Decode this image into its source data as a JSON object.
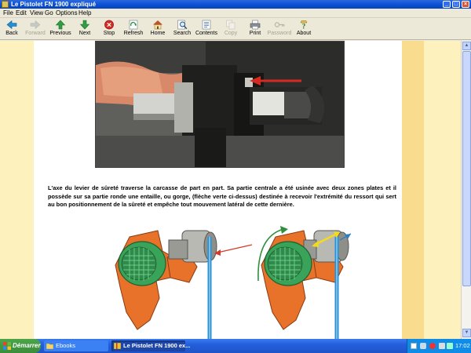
{
  "window": {
    "title": "Le Pistolet FN 1900 expliqué"
  },
  "menu": [
    "File",
    "Edit",
    "View",
    "Go",
    "Options",
    "Help"
  ],
  "toolbar": [
    {
      "label": "Back",
      "icon": "back-icon",
      "enabled": true
    },
    {
      "label": "Forward",
      "icon": "forward-icon",
      "enabled": false
    },
    {
      "label": "Previous",
      "icon": "previous-icon",
      "enabled": true
    },
    {
      "label": "Next",
      "icon": "next-icon",
      "enabled": true
    },
    {
      "label": "Stop",
      "icon": "stop-icon",
      "enabled": true
    },
    {
      "label": "Refresh",
      "icon": "refresh-icon",
      "enabled": true
    },
    {
      "label": "Home",
      "icon": "home-icon",
      "enabled": true
    },
    {
      "label": "Search",
      "icon": "search-icon",
      "enabled": true
    },
    {
      "label": "Contents",
      "icon": "contents-icon",
      "enabled": true
    },
    {
      "label": "Copy",
      "icon": "copy-icon",
      "enabled": false
    },
    {
      "label": "Print",
      "icon": "print-icon",
      "enabled": true
    },
    {
      "label": "Password",
      "icon": "password-icon",
      "enabled": false
    },
    {
      "label": "About",
      "icon": "about-icon",
      "enabled": true
    }
  ],
  "content": {
    "paragraph": "L'axe du levier de sûreté traverse la carcasse de part en part. Sa partie centrale a été usinée avec deux zones plates et il possède sur sa partie ronde une entaille, ou gorge, (flèche verte ci-dessus) destinée à recevoir l'extrémité du ressort qui sert au bon positionnement de la sûreté et empêche tout mouvement latéral de cette dernière."
  },
  "taskbar": {
    "start_label": "Démarrer",
    "tasks": [
      {
        "label": "Ebooks",
        "active": false
      },
      {
        "label": "Le Pistolet FN 1900 ex...",
        "active": true
      }
    ],
    "clock": "17:02"
  },
  "colors": {
    "titlebar": "#0a4fd1",
    "page_bg": "#fdf1bd",
    "stripe": "#f9dc8e",
    "frame_orange": "#e8722a",
    "lever_green": "#3aa35a",
    "spring_blue": "#2d8fd0",
    "arrow_red": "#d43a2a",
    "arrow_green": "#2f8f3a",
    "arrow_yellow": "#f2dc1c",
    "arrow_blue": "#2d7fc0"
  }
}
